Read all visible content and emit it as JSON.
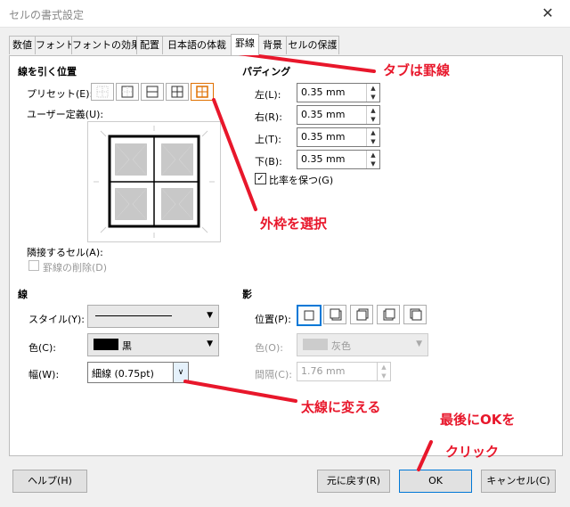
{
  "window": {
    "title": "セルの書式設定",
    "close": "✕"
  },
  "tabs": [
    "数値",
    "フォント",
    "フォントの効果",
    "配置",
    "日本語の体裁",
    "罫線",
    "背景",
    "セルの保護"
  ],
  "lines_section": {
    "title": "線を引く位置",
    "preset_label": "プリセット(E):",
    "user_defined_label": "ユーザー定義(U):",
    "adjacent_label": "隣接するセル(A):",
    "remove_border_label": "罫線の削除(D)"
  },
  "padding": {
    "title": "パディング",
    "left_label": "左(L):",
    "left_value": "0.35 mm",
    "right_label": "右(R):",
    "right_value": "0.35 mm",
    "top_label": "上(T):",
    "top_value": "0.35 mm",
    "bottom_label": "下(B):",
    "bottom_value": "0.35 mm",
    "keep_ratio_label": "比率を保つ(G)",
    "keep_ratio_checked": true
  },
  "line": {
    "title": "線",
    "style_label": "スタイル(Y):",
    "color_label": "色(C):",
    "color_value": "黒",
    "width_label": "幅(W):",
    "width_value": "細線 (0.75pt)"
  },
  "shadow": {
    "title": "影",
    "position_label": "位置(P):",
    "color_label": "色(O):",
    "color_value": "灰色",
    "distance_label": "間隔(C):",
    "distance_value": "1.76 mm"
  },
  "buttons": {
    "help": "ヘルプ(H)",
    "reset": "元に戻す(R)",
    "ok": "OK",
    "cancel": "キャンセル(C)"
  },
  "annotations": {
    "tab_note": "タブは罫線",
    "outer_note": "外枠を選択",
    "thick_note": "太線に変える",
    "ok_note_1": "最後にOKを",
    "ok_note_2": "クリック"
  },
  "colors": {
    "accent": "#0078d7",
    "annotation": "#e8172b",
    "selected_preset": "#e07000"
  }
}
